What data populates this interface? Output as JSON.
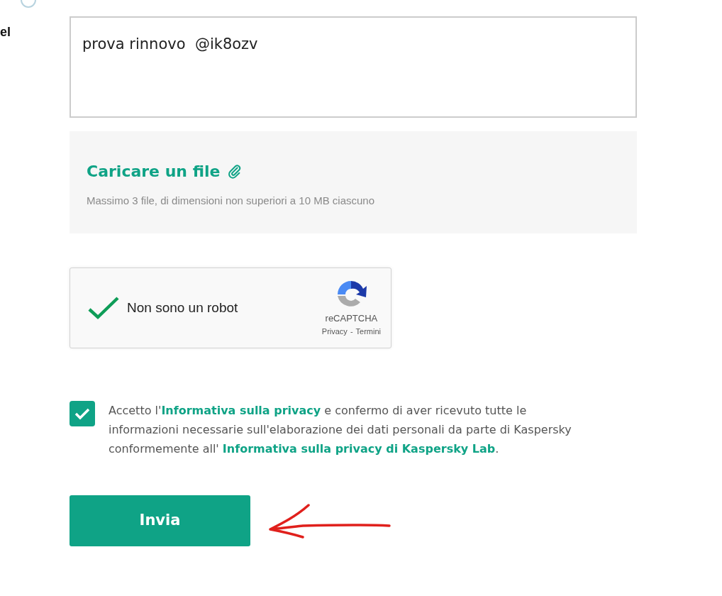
{
  "side_label": "el",
  "message": {
    "value": "prova rinnovo  @ik8ozv"
  },
  "upload": {
    "title": "Caricare un file",
    "hint": "Massimo 3 file, di dimensioni non superiori a 10 MB ciascuno"
  },
  "captcha": {
    "checked": true,
    "label": "Non sono un robot",
    "brand": "reCAPTCHA",
    "links": [
      "Privacy",
      "Termini"
    ],
    "separator": "-"
  },
  "consent": {
    "checked": true,
    "parts": [
      {
        "kind": "text",
        "text": "Accetto l'"
      },
      {
        "kind": "link",
        "text": "Informativa sulla privacy"
      },
      {
        "kind": "text",
        "text": " e confermo di aver ricevuto tutte le informazioni necessarie sull'elaborazione dei dati personali da parte di Kaspersky conformemente all' "
      },
      {
        "kind": "link",
        "text": "Informativa sulla privacy di Kaspersky Lab"
      },
      {
        "kind": "text",
        "text": "."
      }
    ]
  },
  "submit": {
    "label": "Invia"
  }
}
